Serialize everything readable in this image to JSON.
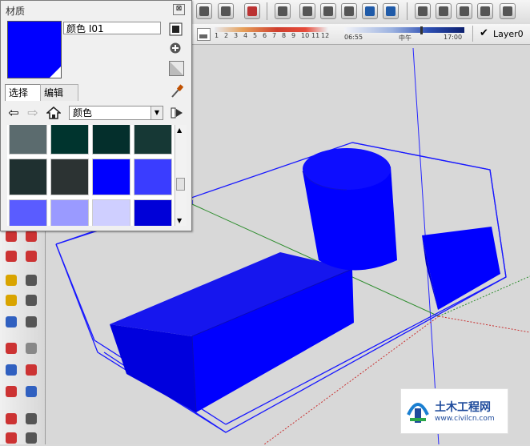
{
  "material_panel": {
    "title": "材质",
    "close_label": "⊠",
    "material_name": "颜色 I01",
    "swatch_color": "#0000ff",
    "tabs": [
      {
        "label": "选择"
      },
      {
        "label": "编辑"
      }
    ],
    "library": "颜色",
    "grid_colors": [
      "#5b6b6e",
      "#00342e",
      "#042f2c",
      "#163835",
      "#1f3030",
      "#2c3333",
      "#0000ff",
      "#3a3dff",
      "#5a5cff",
      "#9a9aff",
      "#cfcfff",
      "#0000d8"
    ]
  },
  "shadow_settings": {
    "months": [
      "1",
      "2",
      "3",
      "4",
      "5",
      "6",
      "7",
      "8",
      "9",
      "10",
      "11",
      "12"
    ],
    "time_start": "06:55",
    "time_noon": "中午",
    "time_end": "17:00"
  },
  "layer": {
    "name": "Layer0"
  },
  "watermark": {
    "title": "土木工程网",
    "url": "www.civilcn.com"
  }
}
